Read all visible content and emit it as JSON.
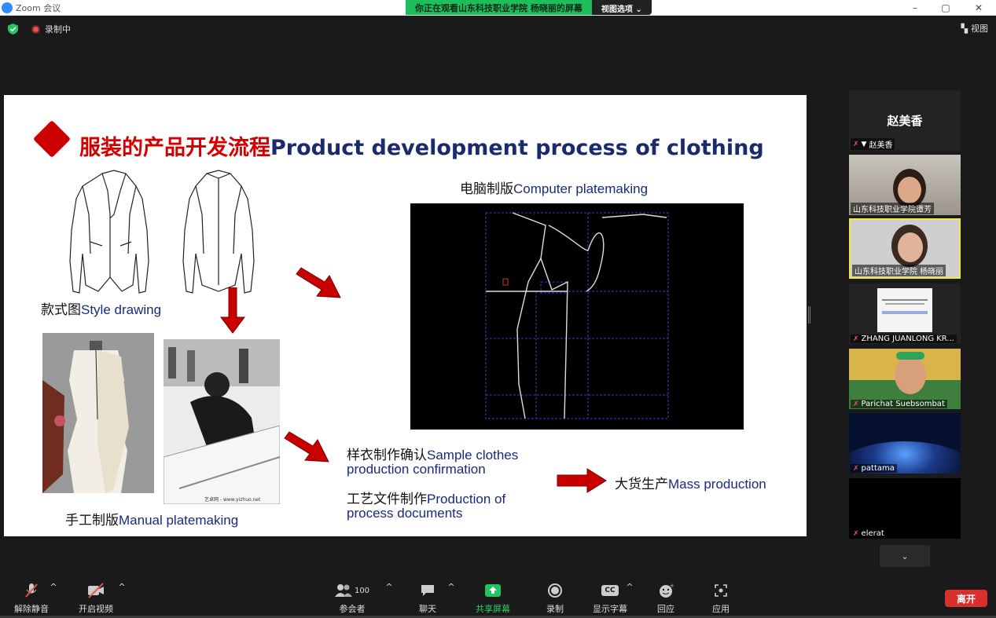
{
  "window": {
    "app_title": "Zoom 会议",
    "controls": [
      "–",
      "▢",
      "✕"
    ]
  },
  "share_banner": {
    "message": "你正在观看山东科技职业学院 杨晓丽的屏幕",
    "options_label": "视图选项 ⌄"
  },
  "topbar": {
    "recording_label": "录制中",
    "view_label": "视图"
  },
  "slide": {
    "title_cn": "服装的产品开发流程",
    "title_en": "Product development process of clothing",
    "style_drawing": {
      "cn": "款式图",
      "en": "Style drawing"
    },
    "computer": {
      "cn": "电脑制版",
      "en": "Computer platemaking"
    },
    "manual": {
      "cn": "手工制版",
      "en": "Manual platemaking"
    },
    "sample": {
      "cn": "样衣制作确认",
      "en1": "Sample clothes",
      "en2": "production confirmation"
    },
    "process": {
      "cn": "工艺文件制作",
      "en1": "Production of",
      "en2": "process documents"
    },
    "mass": {
      "cn": "大货生产",
      "en": "Mass production"
    },
    "watermark": "艺卓网 - www.yizhuo.net"
  },
  "gallery": [
    {
      "name": "赵美香",
      "big_name": "赵美香",
      "muted": true,
      "pinned": true
    },
    {
      "name": "山东科技职业学院谭芳",
      "muted": false
    },
    {
      "name": "山东科技职业学院 杨晓丽",
      "muted": false,
      "active": true
    },
    {
      "name": "ZHANG JUANLONG KR...",
      "muted": true
    },
    {
      "name": "Parichat Suebsombat",
      "muted": true
    },
    {
      "name": "pattama",
      "muted": true
    },
    {
      "name": "elerat",
      "muted": true
    }
  ],
  "toolbar": {
    "unmute": "解除静音",
    "start_video": "开启视频",
    "participants": "参会者",
    "participant_count": "100",
    "chat": "聊天",
    "share_screen": "共享屏幕",
    "record": "录制",
    "captions": "显示字幕",
    "captions_icon": "CC",
    "reactions": "回应",
    "apps": "应用",
    "leave": "离开"
  },
  "colors": {
    "share_green": "#1fbe5c",
    "leave_red": "#d9302c",
    "title_red": "#d40000",
    "title_navy": "#1a2a6c",
    "active_speaker": "#f2e64a"
  }
}
